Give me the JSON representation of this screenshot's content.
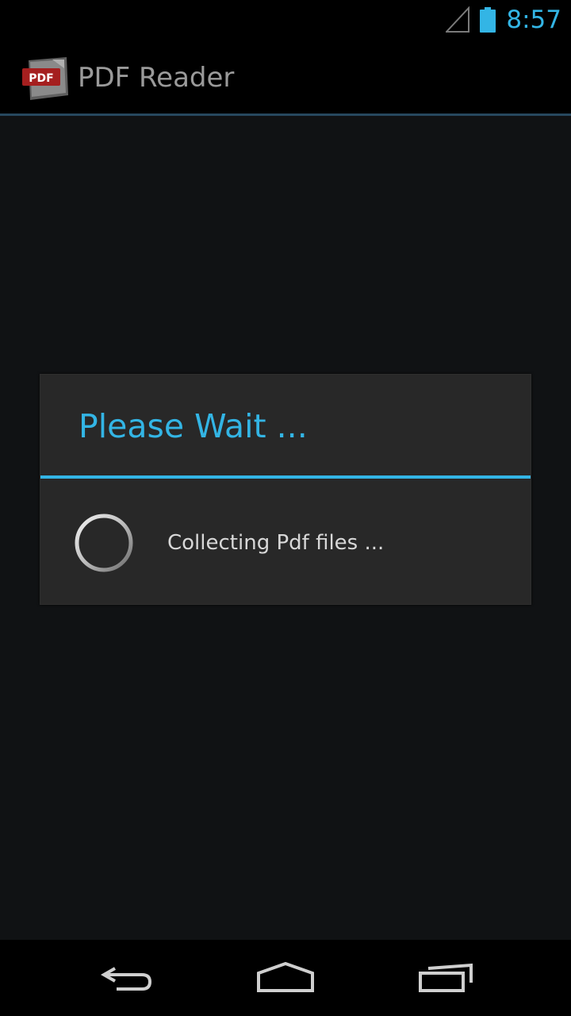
{
  "status_bar": {
    "time": "8:57",
    "icons": [
      "signal-icon",
      "battery-icon"
    ]
  },
  "action_bar": {
    "app_icon_text": "PDF",
    "title": "PDF Reader"
  },
  "dialog": {
    "title": "Please Wait ...",
    "message": "Collecting Pdf files ..."
  },
  "nav_bar": {
    "icons": [
      "back-icon",
      "home-icon",
      "recents-icon"
    ]
  },
  "colors": {
    "accent": "#33b5e5",
    "background": "#101214",
    "dialog_background": "#282828",
    "title_text": "#9a9a9a",
    "message_text": "#d8d8d8"
  }
}
